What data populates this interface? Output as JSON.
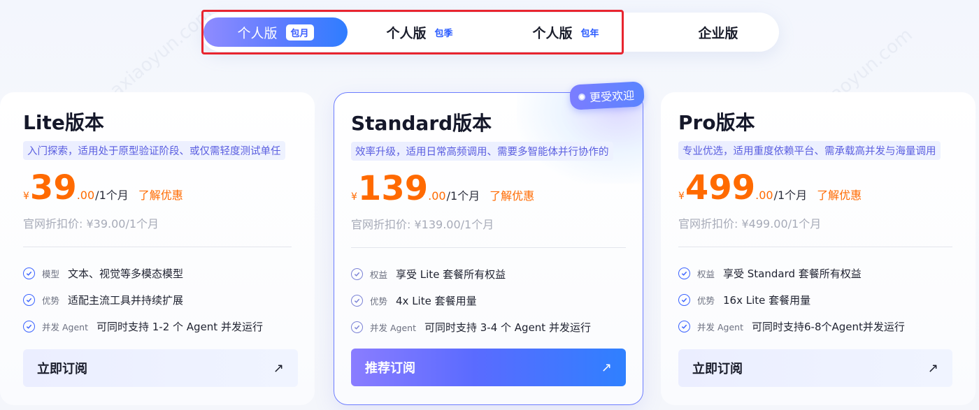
{
  "tabs": [
    {
      "label": "个人版",
      "period": "包月",
      "active": true
    },
    {
      "label": "个人版",
      "period": "包季",
      "active": false
    },
    {
      "label": "个人版",
      "period": "包年",
      "active": false
    },
    {
      "label": "企业版",
      "period": "",
      "active": false
    }
  ],
  "badge": {
    "label": "更受欢迎"
  },
  "cards": [
    {
      "title": "Lite版本",
      "desc": "入门探索，适用处于原型验证阶段、或仅需轻度测试单任",
      "currency": "¥",
      "amount": "39",
      "decimal": ".00",
      "unit": "/1个月",
      "promo": "了解优惠",
      "official": "官网折扣价: ¥39.00/1个月",
      "features": [
        {
          "tag": "模型",
          "text": "文本、视觉等多模态模型"
        },
        {
          "tag": "优势",
          "text": "适配主流工具并持续扩展"
        },
        {
          "tag": "并发 Agent",
          "text": "可同时支持 1-2 个 Agent 并发运行"
        }
      ],
      "cta": "立即订阅",
      "arrow": "↗"
    },
    {
      "title": "Standard版本",
      "desc": "效率升级，适用日常高频调用、需要多智能体并行协作的",
      "currency": "¥",
      "amount": "139",
      "decimal": ".00",
      "unit": "/1个月",
      "promo": "了解优惠",
      "official": "官网折扣价: ¥139.00/1个月",
      "features": [
        {
          "tag": "权益",
          "text": "享受 Lite 套餐所有权益"
        },
        {
          "tag": "优势",
          "text": "4x Lite 套餐用量"
        },
        {
          "tag": "并发 Agent",
          "text": "可同时支持 3-4 个 Agent 并发运行"
        }
      ],
      "cta": "推荐订阅",
      "arrow": "↗"
    },
    {
      "title": "Pro版本",
      "desc": "专业优选，适用重度依赖平台、需承载高并发与海量调用",
      "currency": "¥",
      "amount": "499",
      "decimal": ".00",
      "unit": "/1个月",
      "promo": "了解优惠",
      "official": "官网折扣价: ¥499.00/1个月",
      "features": [
        {
          "tag": "权益",
          "text": "享受 Standard 套餐所有权益"
        },
        {
          "tag": "优势",
          "text": "16x Lite 套餐用量"
        },
        {
          "tag": "并发 Agent",
          "text": "可同时支持6-8个Agent并发运行"
        }
      ],
      "cta": "立即订阅",
      "arrow": "↗"
    }
  ],
  "watermark": "axiaoyun.com",
  "colors": {
    "accent": "#2f7dff",
    "price": "#ff6a00",
    "highlight_border": "#e8252f"
  }
}
